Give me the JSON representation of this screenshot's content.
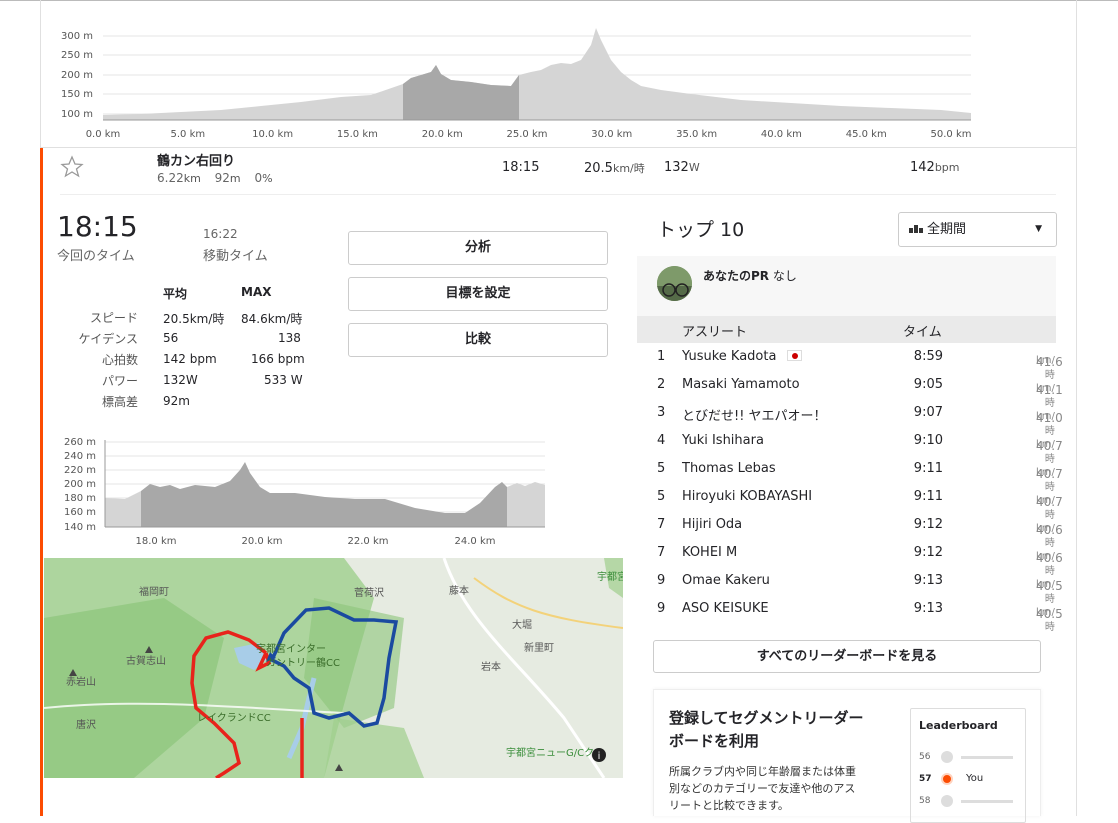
{
  "top_elevation": {
    "y_ticks": [
      "300 m",
      "250 m",
      "200 m",
      "150 m",
      "100 m"
    ],
    "x_ticks": [
      "0.0 km",
      "5.0 km",
      "10.0 km",
      "15.0 km",
      "20.0 km",
      "25.0 km",
      "30.0 km",
      "35.0 km",
      "40.0 km",
      "45.0 km",
      "50.0 km"
    ]
  },
  "segment_row": {
    "name": "鶴カン右回り",
    "distance": "6.22",
    "distance_unit": "km",
    "elev": "92",
    "elev_unit": "m",
    "grade": "0",
    "grade_unit": "%",
    "time": "18:15",
    "speed": "20.5",
    "speed_unit": "km/時",
    "power": "132",
    "power_unit": "W",
    "hr": "142",
    "hr_unit": "bpm"
  },
  "effort": {
    "time": "18:15",
    "time_label": "今回のタイム",
    "moving_time": "16:22",
    "moving_label": "移動タイム",
    "col_avg": "平均",
    "col_max": "MAX",
    "rows": [
      {
        "label": "スピード",
        "avg": "20.5km/時",
        "max": "84.6km/時"
      },
      {
        "label": "ケイデンス",
        "avg": "56",
        "max": "138"
      },
      {
        "label": "心拍数",
        "avg": "142 bpm",
        "max": "166 bpm"
      },
      {
        "label": "パワー",
        "avg": "132W",
        "max": "533 W"
      },
      {
        "label": "標高差",
        "avg": "92m",
        "max": ""
      }
    ]
  },
  "buttons": {
    "analyze": "分析",
    "goal": "目標を設定",
    "compare": "比較"
  },
  "seg_elevation": {
    "y_ticks": [
      "260 m",
      "240 m",
      "220 m",
      "200 m",
      "180 m",
      "160 m",
      "140 m"
    ],
    "x_ticks": [
      "18.0 km",
      "20.0 km",
      "22.0 km",
      "24.0 km"
    ]
  },
  "map_labels": {
    "fukuoka": "福岡町",
    "shiraishi": "菅荷沢",
    "fujimoto": "藤本",
    "utsunomiya_top": "宇都宮",
    "okubo": "大堀",
    "shinsato": "新里町",
    "iwamoto": "岩本",
    "koga": "古賀志山",
    "akaiwa": "赤岩山",
    "karasawa": "唐沢",
    "lakeland": "レイクランドCC",
    "interchange": "宇都宮インター",
    "tsuru": "カントリー鶴CC",
    "newcc": "宇都宮ニューG/Cク"
  },
  "leaderboard": {
    "title": "トップ 10",
    "filter": "全期間",
    "pr_label": "あなたのPR",
    "pr_value": "なし",
    "col_athlete": "アスリート",
    "col_time": "タイム",
    "rows": [
      {
        "rank": "1",
        "name": "Yusuke Kadota",
        "time": "8:59",
        "speed": "41.6",
        "unit": "km/時",
        "flag": "jp"
      },
      {
        "rank": "2",
        "name": "Masaki Yamamoto",
        "time": "9:05",
        "speed": "41.1",
        "unit": "km/時"
      },
      {
        "rank": "3",
        "name": "とびだせ!! ヤエパオー！",
        "time": "9:07",
        "speed": "41.0",
        "unit": "km/時"
      },
      {
        "rank": "4",
        "name": "Yuki Ishihara",
        "time": "9:10",
        "speed": "40.7",
        "unit": "km/時"
      },
      {
        "rank": "5",
        "name": "Thomas Lebas",
        "time": "9:11",
        "speed": "40.7",
        "unit": "km/時"
      },
      {
        "rank": "5",
        "name": "Hiroyuki KOBAYASHI",
        "time": "9:11",
        "speed": "40.7",
        "unit": "km/時"
      },
      {
        "rank": "7",
        "name": "Hijiri Oda",
        "time": "9:12",
        "speed": "40.6",
        "unit": "km/時"
      },
      {
        "rank": "7",
        "name": "KOHEI M",
        "time": "9:12",
        "speed": "40.6",
        "unit": "km/時"
      },
      {
        "rank": "9",
        "name": "Omae Kakeru",
        "time": "9:13",
        "speed": "40.5",
        "unit": "km/時"
      },
      {
        "rank": "9",
        "name": "ASO KEISUKE",
        "time": "9:13",
        "speed": "40.5",
        "unit": "km/時"
      }
    ],
    "view_all": "すべてのリーダーボードを見る"
  },
  "promo": {
    "title_line1": "登録してセグメントリーダー",
    "title_line2": "ボードを利用",
    "body_line1": "所属クラブ内や同じ年齢層または体重",
    "body_line2": "別などのカテゴリーで友達や他のアス",
    "body_line3": "リートと比較できます。",
    "card_title": "Leaderboard",
    "card_ranks": [
      "56",
      "57",
      "58"
    ],
    "card_you": "You"
  },
  "colors": {
    "accent": "#fc4c02",
    "route_blue": "#1a4aa0",
    "route_red": "#e8231b",
    "map_green": "#9fcf8d"
  }
}
